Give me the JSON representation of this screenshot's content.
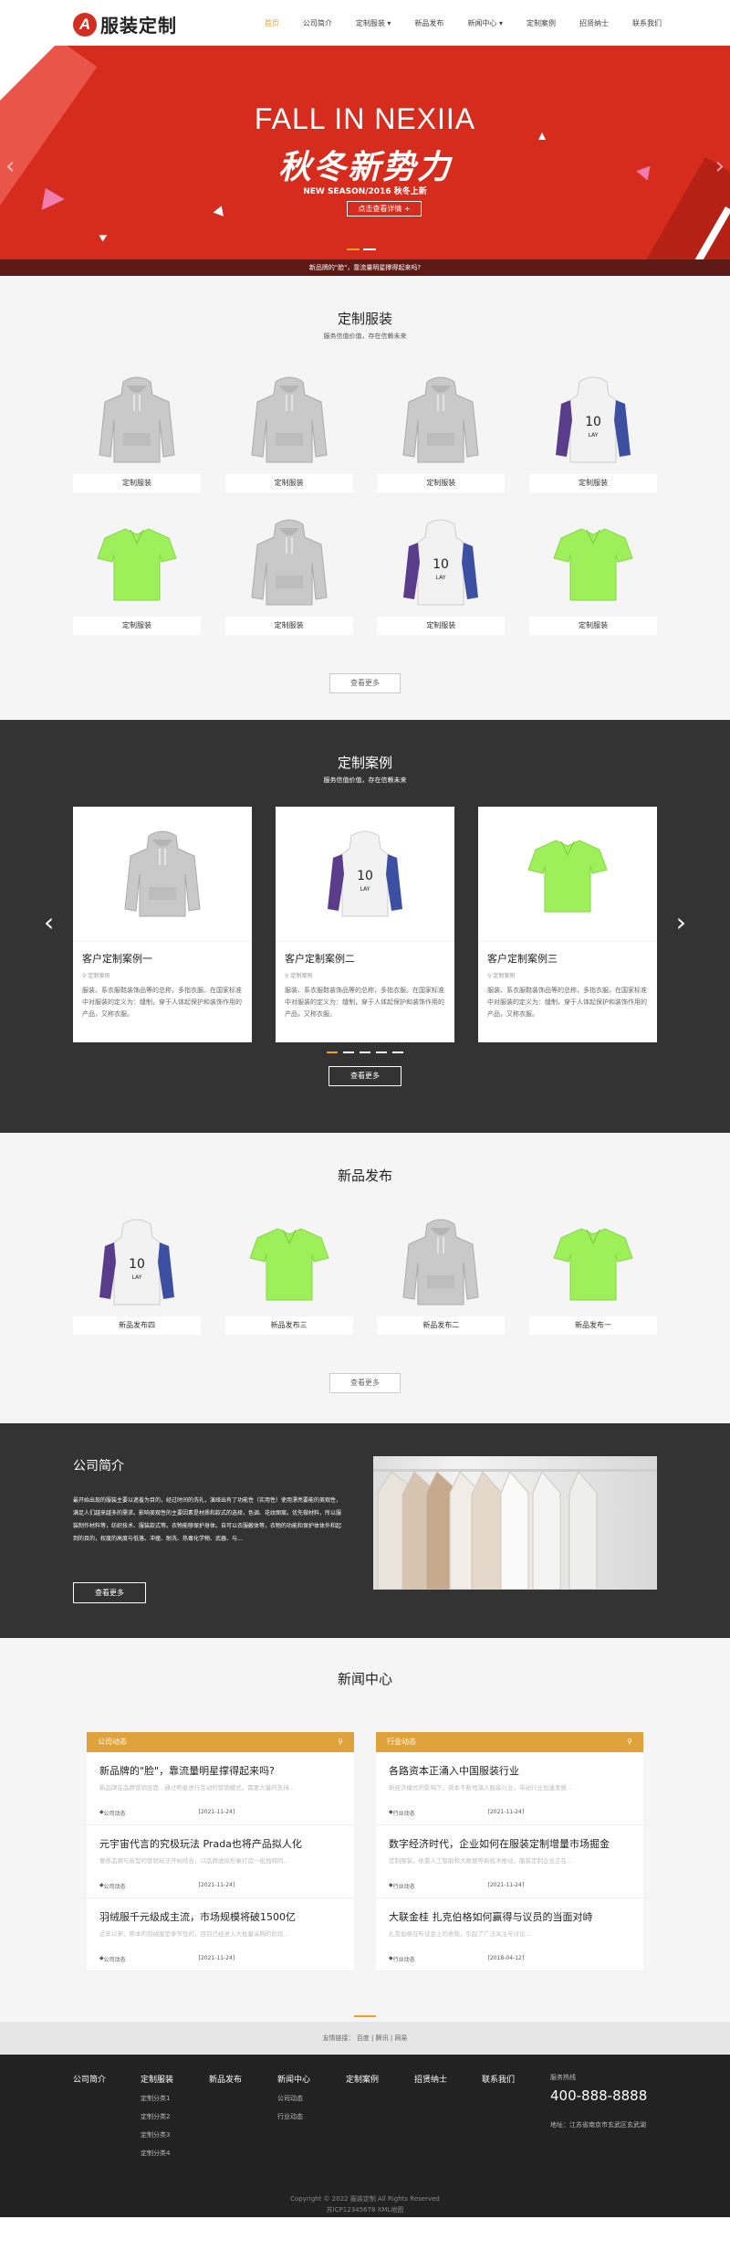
{
  "header": {
    "logo_letter": "A",
    "logo_text": "服装定制",
    "nav": [
      {
        "label": "首页",
        "active": true
      },
      {
        "label": "公司简介",
        "active": false
      },
      {
        "label": "定制服装 ▾",
        "active": false
      },
      {
        "label": "新品发布",
        "active": false
      },
      {
        "label": "新闻中心 ▾",
        "active": false
      },
      {
        "label": "定制案例",
        "active": false
      },
      {
        "label": "招贤纳士",
        "active": false
      },
      {
        "label": "联系我们",
        "active": false
      }
    ]
  },
  "banner": {
    "title": "FALL IN NEXIIA",
    "subtitle": "秋冬新势力",
    "season": "NEW SEASON/2016 秋冬上新",
    "button": "点击查看详情 +",
    "notice": "新品牌的\"脸\"，靠流量明星撑得起来吗?",
    "bg_color": "#d62c1e"
  },
  "products": {
    "title": "定制服装",
    "subtitle": "服务信值价值，存在信赖未来",
    "items": [
      {
        "label": "定制服装",
        "icon": "grey-hoodie"
      },
      {
        "label": "定制服装",
        "icon": "grey-hoodie"
      },
      {
        "label": "定制服装",
        "icon": "grey-hoodie"
      },
      {
        "label": "定制服装",
        "icon": "white-purple-hoodie"
      },
      {
        "label": "定制服装",
        "icon": "green-polo"
      },
      {
        "label": "定制服装",
        "icon": "grey-hoodie"
      },
      {
        "label": "定制服装",
        "icon": "white-purple-hoodie"
      },
      {
        "label": "定制服装",
        "icon": "green-polo"
      }
    ],
    "more": "查看更多"
  },
  "cases": {
    "title": "定制案例",
    "subtitle": "服务信值价值，存在信赖未来",
    "items": [
      {
        "title": "客户定制案例一",
        "meta": "定制案例",
        "desc": "服装、系衣服鞋装饰品等的总称，多指衣服。在国家标准中对服装的定义为：缝制，穿于人体起保护和装饰作用的产品，又称衣服。",
        "icon": "grey-hoodie"
      },
      {
        "title": "客户定制案例二",
        "meta": "定制案例",
        "desc": "服装、系衣服鞋装饰品等的总称，多指衣服。在国家标准中对服装的定义为：缝制，穿于人体起保护和装饰作用的产品，又称衣服。",
        "icon": "white-purple-hoodie"
      },
      {
        "title": "客户定制案例三",
        "meta": "定制案例",
        "desc": "服装、系衣服鞋装饰品等的总称，多指衣服。在国家标准中对服装的定义为：缝制，穿于人体起保护和装饰作用的产品，又称衣服。",
        "icon": "green-polo"
      }
    ],
    "more": "查看更多"
  },
  "newproducts": {
    "title": "新品发布",
    "items": [
      {
        "label": "新品发布四",
        "icon": "white-purple-hoodie"
      },
      {
        "label": "新品发布三",
        "icon": "green-polo"
      },
      {
        "label": "新品发布二",
        "icon": "grey-hoodie"
      },
      {
        "label": "新品发布一",
        "icon": "green-polo"
      }
    ],
    "more": "查看更多"
  },
  "about": {
    "title": "公司简介",
    "text": "最开始出现的服装主要以遮羞为目的，经过时间的洗礼，演绎出有了功能性（实用性）使用漂亮要能的美观性，满足人们越来越多的需求。影响美观性的主要因素是材质和款式的选择，色调、花纹图案。优先做材料，所以服装制作材料等，纺织技术、服装款式等。衣物能够保护身体。自可以衣服蔽体等，衣物的功能和保护体体外和起到的目的，权度的高度与低落。冲撞、耐洗、热毒化学物、武器、与...",
    "more": "查看更多"
  },
  "news": {
    "title": "新闻中心",
    "columns": [
      {
        "head": "公司动态",
        "items": [
          {
            "title": "新品牌的\"脸\"，靠流量明星撑得起来吗?",
            "desc": "新品牌在品牌营销层面...通过明星进行互动的营销模式，需要大量的支持...",
            "tag": "公司动态",
            "date": "[2021-11-24]"
          },
          {
            "title": "元宇宙代言的究极玩法 Prada也将产品拟人化",
            "desc": "奢侈品牌与新型的营销玩法开始结合，以品牌虚拟形象打造一批独特的...",
            "tag": "公司动态",
            "date": "[2021-11-24]"
          },
          {
            "title": "羽绒服千元级成主流，市场规模将破1500亿",
            "desc": "近年以来，原本的羽绒服是季节性的，目前已经进入大批量采购的阶段...",
            "tag": "公司动态",
            "date": "[2021-11-24]"
          }
        ]
      },
      {
        "head": "行业动态",
        "items": [
          {
            "title": "各路资本正涌入中国服装行业",
            "desc": "新经济模式的影响下，资本不断地涌入服装行业，带动行业加速发展...",
            "tag": "行业动态",
            "date": "[2021-11-24]"
          },
          {
            "title": "数字经济时代，企业如何在服装定制增量市场掘金",
            "desc": "定制服装，依靠人工智能和大数据等新技术推动，服装定制企业正在...",
            "tag": "行业动态",
            "date": "[2021-11-24]"
          },
          {
            "title": "大联金桂 扎克伯格如何赢得与议员的当面对峙",
            "desc": "扎克伯格在听证会上的表现，引起了广泛关注与讨论...",
            "tag": "行业动态",
            "date": "[2018-04-12]"
          }
        ]
      }
    ]
  },
  "links": {
    "label": "友情链接：",
    "items": [
      "百度",
      "腾讯",
      "网易"
    ]
  },
  "footer": {
    "cols": [
      {
        "head": "公司简介",
        "items": []
      },
      {
        "head": "定制服装",
        "items": [
          "定制分类1",
          "定制分类2",
          "定制分类3",
          "定制分类4"
        ]
      },
      {
        "head": "新品发布",
        "items": []
      },
      {
        "head": "新闻中心",
        "items": [
          "公司动态",
          "行业动态"
        ]
      },
      {
        "head": "定制案例",
        "items": []
      },
      {
        "head": "招贤纳士",
        "items": []
      },
      {
        "head": "联系我们",
        "items": []
      }
    ],
    "hotline_label": "服务热线",
    "hotline": "400-888-8888",
    "address": "地址：江苏省南京市玄武区玄武湖",
    "copyright": "Copyright © 2022 服装定制 All Rights Reserved",
    "icp": "苏ICP12345678 XML地图"
  }
}
